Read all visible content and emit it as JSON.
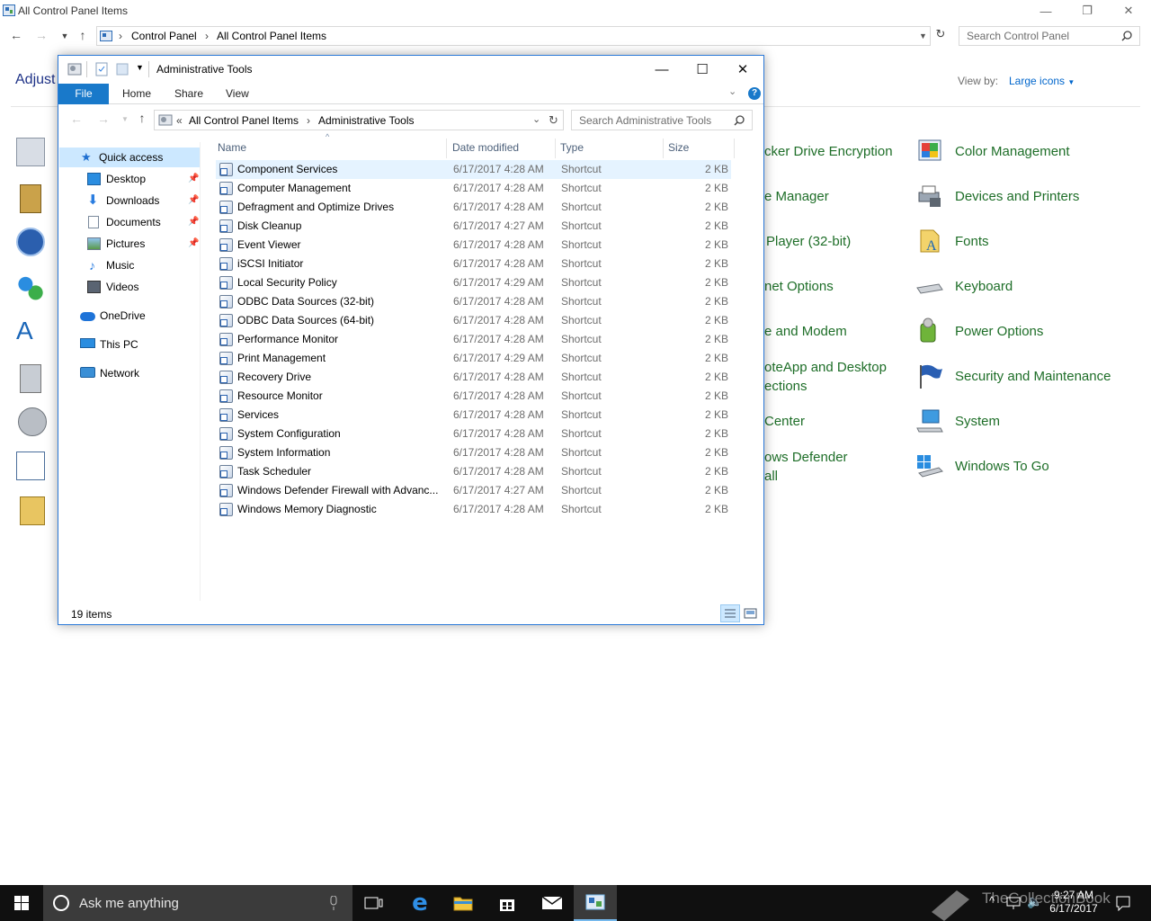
{
  "control_panel": {
    "title": "All Control Panel Items",
    "breadcrumb": [
      "Control Panel",
      "All Control Panel Items"
    ],
    "search_placeholder": "Search Control Panel",
    "heading_partial": "Adjust",
    "view_by_label": "View by:",
    "view_by_value": "Large icons",
    "middle_column_partial": [
      "cker Drive Encryption",
      "e Manager",
      "Player (32-bit)",
      "net Options",
      "e and Modem",
      "oteApp and Desktop",
      "ections",
      "Center",
      "ows Defender",
      "all"
    ],
    "right_column": [
      {
        "label": "Color Management",
        "icon": "color-management-icon"
      },
      {
        "label": "Devices and Printers",
        "icon": "printer-icon"
      },
      {
        "label": "Fonts",
        "icon": "fonts-icon"
      },
      {
        "label": "Keyboard",
        "icon": "keyboard-icon"
      },
      {
        "label": "Power Options",
        "icon": "power-icon"
      },
      {
        "label": "Security and Maintenance",
        "icon": "flag-icon"
      },
      {
        "label": "System",
        "icon": "computer-icon"
      },
      {
        "label": "Windows To Go",
        "icon": "usb-drive-icon"
      }
    ]
  },
  "explorer": {
    "title": "Administrative Tools",
    "ribbon_tabs": [
      "File",
      "Home",
      "Share",
      "View"
    ],
    "help_label": "?",
    "address": {
      "prefix": "«",
      "parts": [
        "All Control Panel Items",
        "Administrative Tools"
      ]
    },
    "search_placeholder": "Search Administrative Tools",
    "nav": {
      "quick_access": "Quick access",
      "items": [
        "Desktop",
        "Downloads",
        "Documents",
        "Pictures",
        "Music",
        "Videos"
      ],
      "onedrive": "OneDrive",
      "this_pc": "This PC",
      "network": "Network"
    },
    "columns": [
      "Name",
      "Date modified",
      "Type",
      "Size"
    ],
    "files": [
      {
        "name": "Component Services",
        "date": "6/17/2017 4:28 AM",
        "type": "Shortcut",
        "size": "2 KB"
      },
      {
        "name": "Computer Management",
        "date": "6/17/2017 4:28 AM",
        "type": "Shortcut",
        "size": "2 KB"
      },
      {
        "name": "Defragment and Optimize Drives",
        "date": "6/17/2017 4:28 AM",
        "type": "Shortcut",
        "size": "2 KB"
      },
      {
        "name": "Disk Cleanup",
        "date": "6/17/2017 4:27 AM",
        "type": "Shortcut",
        "size": "2 KB"
      },
      {
        "name": "Event Viewer",
        "date": "6/17/2017 4:28 AM",
        "type": "Shortcut",
        "size": "2 KB"
      },
      {
        "name": "iSCSI Initiator",
        "date": "6/17/2017 4:28 AM",
        "type": "Shortcut",
        "size": "2 KB"
      },
      {
        "name": "Local Security Policy",
        "date": "6/17/2017 4:29 AM",
        "type": "Shortcut",
        "size": "2 KB"
      },
      {
        "name": "ODBC Data Sources (32-bit)",
        "date": "6/17/2017 4:28 AM",
        "type": "Shortcut",
        "size": "2 KB"
      },
      {
        "name": "ODBC Data Sources (64-bit)",
        "date": "6/17/2017 4:28 AM",
        "type": "Shortcut",
        "size": "2 KB"
      },
      {
        "name": "Performance Monitor",
        "date": "6/17/2017 4:28 AM",
        "type": "Shortcut",
        "size": "2 KB"
      },
      {
        "name": "Print Management",
        "date": "6/17/2017 4:29 AM",
        "type": "Shortcut",
        "size": "2 KB"
      },
      {
        "name": "Recovery Drive",
        "date": "6/17/2017 4:28 AM",
        "type": "Shortcut",
        "size": "2 KB"
      },
      {
        "name": "Resource Monitor",
        "date": "6/17/2017 4:28 AM",
        "type": "Shortcut",
        "size": "2 KB"
      },
      {
        "name": "Services",
        "date": "6/17/2017 4:28 AM",
        "type": "Shortcut",
        "size": "2 KB"
      },
      {
        "name": "System Configuration",
        "date": "6/17/2017 4:28 AM",
        "type": "Shortcut",
        "size": "2 KB"
      },
      {
        "name": "System Information",
        "date": "6/17/2017 4:28 AM",
        "type": "Shortcut",
        "size": "2 KB"
      },
      {
        "name": "Task Scheduler",
        "date": "6/17/2017 4:28 AM",
        "type": "Shortcut",
        "size": "2 KB"
      },
      {
        "name": "Windows Defender Firewall with Advanc...",
        "date": "6/17/2017 4:27 AM",
        "type": "Shortcut",
        "size": "2 KB"
      },
      {
        "name": "Windows Memory Diagnostic",
        "date": "6/17/2017 4:28 AM",
        "type": "Shortcut",
        "size": "2 KB"
      }
    ],
    "status": "19 items"
  },
  "taskbar": {
    "search_placeholder": "Ask me anything",
    "time": "9:27 AM",
    "date": "6/17/2017",
    "watermark": "TheCollectionBook"
  },
  "colors": {
    "accent": "#1979ca",
    "link_green": "#1e6e28",
    "selection": "#cce8ff",
    "taskbar": "#101010"
  }
}
